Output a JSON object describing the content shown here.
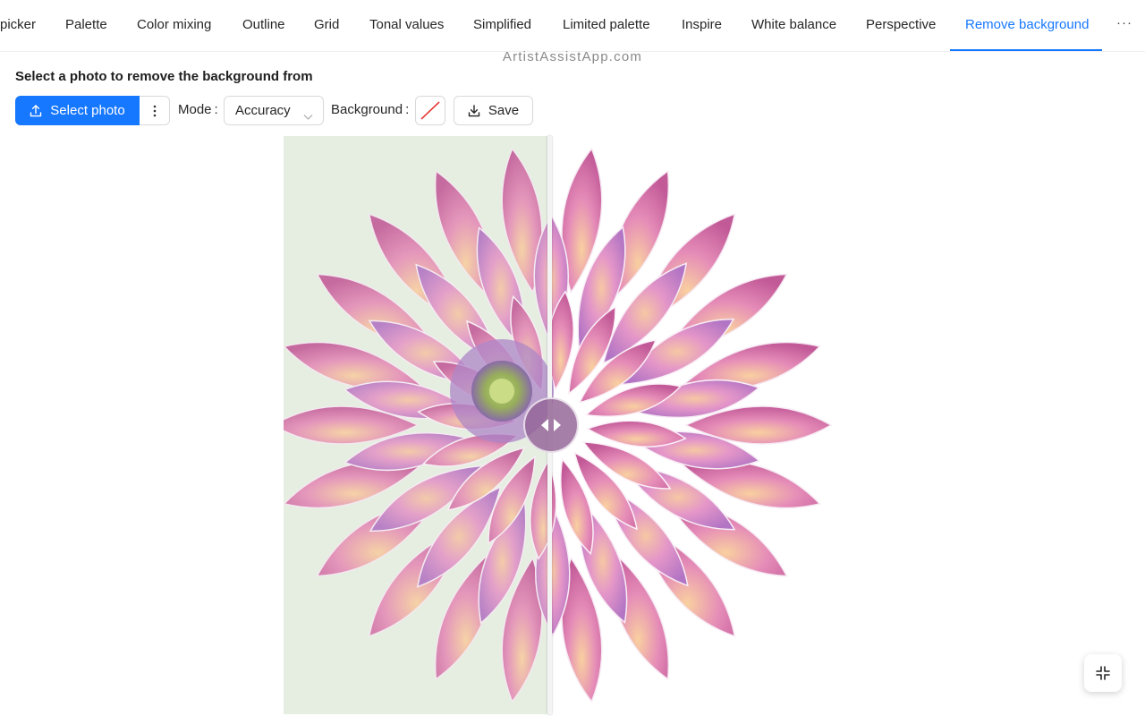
{
  "tabs": [
    {
      "label": "picker",
      "active": false
    },
    {
      "label": "Palette",
      "active": false
    },
    {
      "label": "Color mixing",
      "active": false
    },
    {
      "label": "Outline",
      "active": false
    },
    {
      "label": "Grid",
      "active": false
    },
    {
      "label": "Tonal values",
      "active": false
    },
    {
      "label": "Simplified",
      "active": false
    },
    {
      "label": "Limited palette",
      "active": false
    },
    {
      "label": "Inspire",
      "active": false
    },
    {
      "label": "White balance",
      "active": false
    },
    {
      "label": "Perspective",
      "active": false
    },
    {
      "label": "Remove background",
      "active": true
    }
  ],
  "tabs_more_label": "···",
  "watermark": "ArtistAssistApp.com",
  "heading": "Select a photo to remove the background from",
  "toolbar": {
    "select_photo_label": "Select photo",
    "more_icon": "more-vertical-icon",
    "mode_label": "Mode",
    "mode_value": "Accuracy",
    "background_label": "Background",
    "background_value": "transparent",
    "save_label": "Save"
  },
  "viewer": {
    "left_image": "original photo with background",
    "right_image": "background removed",
    "handle_icon": "compare-arrows-icon"
  },
  "fullscreen_icon": "exit-fullscreen-icon",
  "colors": {
    "accent": "#1677ff",
    "original_background": "#e7f0e4",
    "petal_pink": "#d98cc2",
    "petal_purple": "#9a5fb0",
    "center_green": "#9ab85a"
  }
}
